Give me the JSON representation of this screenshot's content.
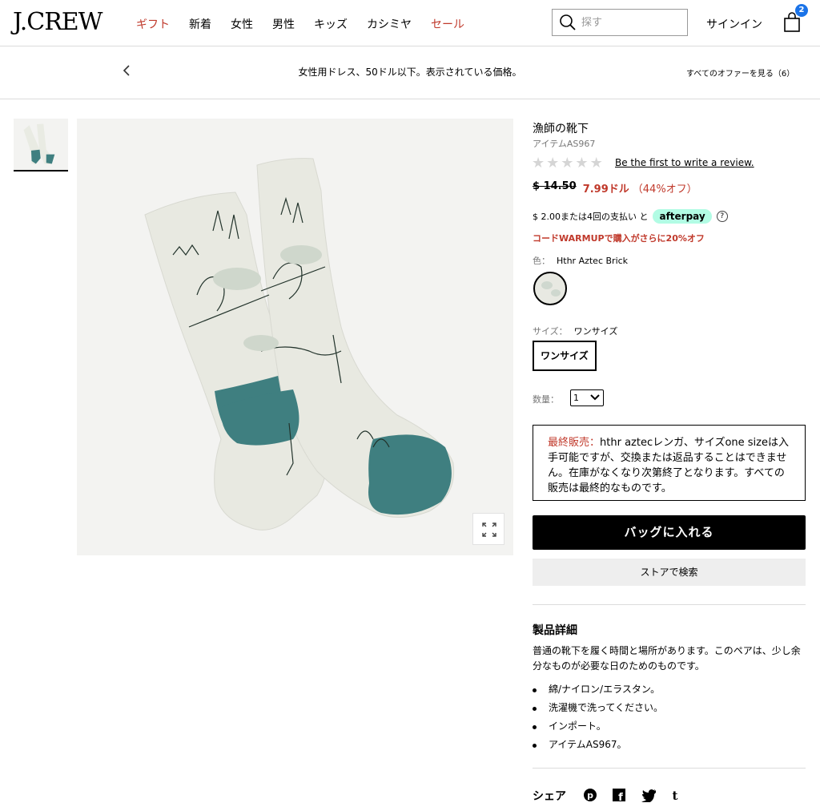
{
  "header": {
    "logo": "J.CREW",
    "nav": [
      {
        "label": "ギフト",
        "color": "#c0392b"
      },
      {
        "label": "新着"
      },
      {
        "label": "女性"
      },
      {
        "label": "男性"
      },
      {
        "label": "キッズ"
      },
      {
        "label": "カシミヤ"
      },
      {
        "label": "セール",
        "color": "#c0392b"
      }
    ],
    "search_placeholder": "探す",
    "signin": "サインイン",
    "bag_count": "2"
  },
  "promo": {
    "text": "女性用ドレス、50ドル以下。表示されている価格。",
    "offers_link": "すべてのオファーを見る（6）"
  },
  "product": {
    "title": "漁師の靴下",
    "item_number": "アイテムAS967",
    "review_link": "Be the first to write a review.",
    "old_price": "$ 14.50",
    "new_price": "7.99ドル",
    "discount": "（44%オフ）",
    "afterpay_text": "$ 2.00または4回の支払い と",
    "afterpay_brand": "afterpay",
    "promo_code": "コードWARMUPで購入がさらに20%オフ",
    "color_label": "色：",
    "color_value": "Hthr Aztec Brick",
    "size_label": "サイズ：",
    "size_value": "ワンサイズ",
    "size_button": "ワンサイズ",
    "qty_label": "数量：",
    "qty_value": "1",
    "final_sale_label": "最終販売：",
    "final_sale_text": "hthr aztecレンガ、サイズone sizeは入手可能ですが、交換または返品することはできません。在庫がなくなり次第終了となります。すべての販売は最終的なものです。",
    "add_to_bag": "バッグに入れる",
    "find_in_store": "ストアで検索",
    "details_title": "製品詳細",
    "details_desc": "普通の靴下を履く時間と場所があります。このペアは、少し余分なものが必要な日のためのものです。",
    "details_list": [
      "綿/ナイロン/エラスタン。",
      "洗濯機で洗ってください。",
      "インポート。",
      "アイテムAS967。"
    ],
    "share_label": "シェア"
  },
  "icons": {
    "search": "search-icon",
    "bag": "shopping-bag-icon",
    "prev": "chevron-left-icon",
    "zoom": "expand-icon",
    "help": "question-icon",
    "pinterest": "pinterest-icon",
    "facebook": "facebook-icon",
    "twitter": "twitter-icon",
    "tumblr": "tumblr-icon"
  },
  "colors": {
    "accent_red": "#c0392b",
    "badge_blue": "#1a73e8",
    "afterpay_mint": "#b2fce4",
    "sock_teal": "#3f7f80"
  }
}
